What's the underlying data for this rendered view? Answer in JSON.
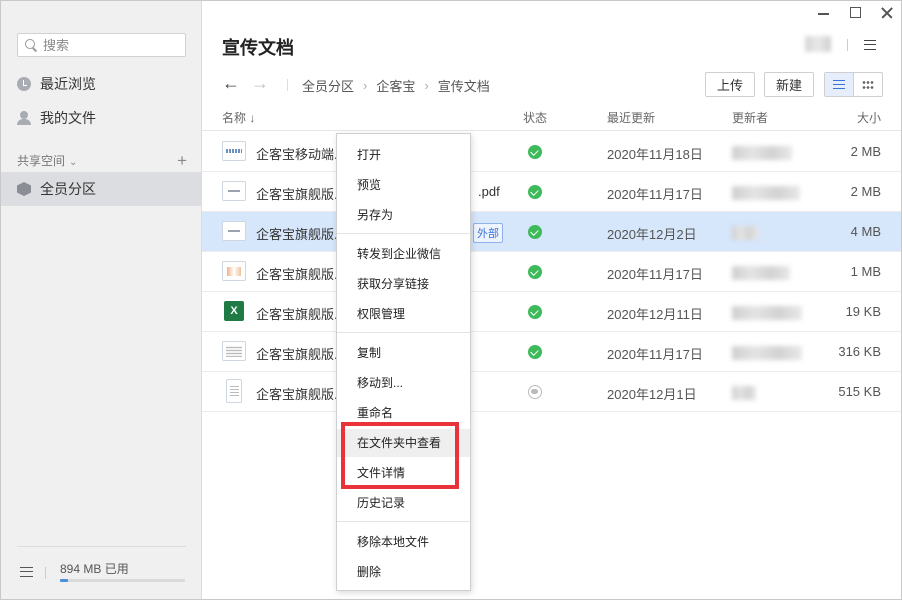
{
  "sidebar": {
    "search_placeholder": "搜索",
    "nav": [
      {
        "label": "最近浏览",
        "icon": "clock-icon"
      },
      {
        "label": "我的文件",
        "icon": "user-icon"
      }
    ],
    "shared_space": {
      "label": "共享空间",
      "add": "+"
    },
    "spaces": [
      {
        "label": "全员分区",
        "icon": "cube-icon"
      }
    ],
    "usage": {
      "label": "894 MB 已用",
      "fraction": 0.06
    }
  },
  "main": {
    "title": "宣传文档",
    "toolbar": {
      "back": "←",
      "forward": "→",
      "breadcrumb": [
        "全员分区",
        "企客宝",
        "宣传文档"
      ],
      "upload": "上传",
      "new": "新建"
    },
    "columns": {
      "name": "名称 ↓",
      "status": "状态",
      "updated": "最近更新",
      "updater": "更新者",
      "size": "大小"
    },
    "files": [
      {
        "name": "企客宝移动端...",
        "ext": "",
        "tag": "",
        "status": "synced",
        "date": "2020年11月18日",
        "size": "2 MB",
        "icon": "image-file-icon"
      },
      {
        "name": "企客宝旗舰版...",
        "ext": ".pdf",
        "tag": "",
        "status": "synced",
        "date": "2020年11月17日",
        "size": "2 MB",
        "icon": "doc-file-icon"
      },
      {
        "name": "企客宝旗舰版...",
        "ext": "",
        "tag": "外部",
        "status": "synced",
        "date": "2020年12月2日",
        "size": "4 MB",
        "icon": "doc-file-icon"
      },
      {
        "name": "企客宝旗舰版...",
        "ext": "",
        "tag": "",
        "status": "synced",
        "date": "2020年11月17日",
        "size": "1 MB",
        "icon": "color-file-icon"
      },
      {
        "name": "企客宝旗舰版...",
        "ext": "",
        "tag": "",
        "status": "synced",
        "date": "2020年12月11日",
        "size": "19 KB",
        "icon": "excel-file-icon"
      },
      {
        "name": "企客宝旗舰版...",
        "ext": "",
        "tag": "",
        "status": "synced",
        "date": "2020年11月17日",
        "size": "316 KB",
        "icon": "gray-file-icon"
      },
      {
        "name": "企客宝旗舰版...",
        "ext": "",
        "tag": "",
        "status": "cloud",
        "date": "2020年12月1日",
        "size": "515 KB",
        "icon": "page-file-icon"
      }
    ]
  },
  "context_menu": {
    "items": [
      "打开",
      "预览",
      "另存为",
      "转发到企业微信",
      "获取分享链接",
      "权限管理",
      "复制",
      "移动到...",
      "重命名",
      "在文件夹中查看",
      "文件详情",
      "历史记录",
      "移除本地文件",
      "删除"
    ],
    "highlight_color": "#e8333a"
  },
  "colors": {
    "accent": "#3a73d8",
    "selected_row": "#d6e6fb",
    "status_ok": "#3fba5a"
  }
}
